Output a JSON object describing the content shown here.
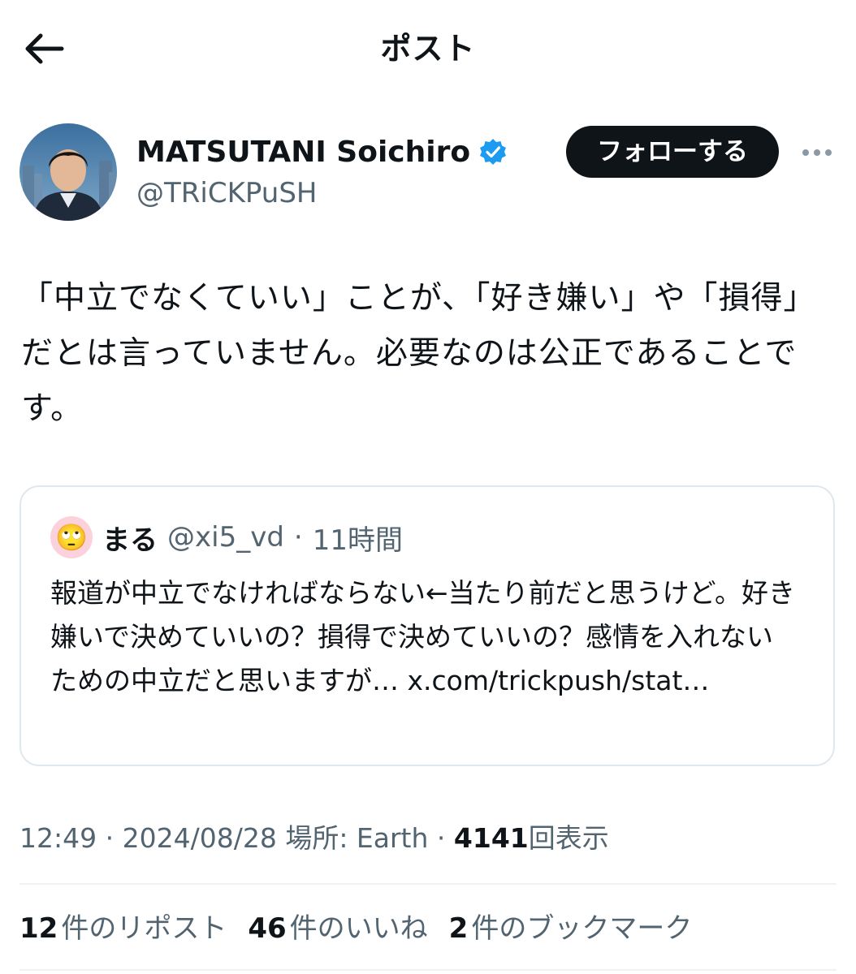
{
  "header": {
    "title": "ポスト",
    "back_icon": "arrow-left-icon"
  },
  "author": {
    "display_name": "MATSUTANI Soichiro",
    "handle": "@TRiCKPuSH",
    "verified_icon": "verified-badge-icon",
    "follow_label": "フォローする",
    "more_icon": "more-horizontal-icon"
  },
  "post": {
    "text": "「中立でなくていい」ことが、「好き嫌い」や「損得」だとは言っていません。必要なのは公正であることです。"
  },
  "quote": {
    "avatar_emoji": "🙄",
    "name": "まる",
    "handle": "@xi5_vd",
    "separator": "·",
    "time": "11時間",
    "text": "報道が中立でなければならない←当たり前だと思うけど。好き嫌いで決めていいの？損得で決めていいの？感情を入れないための中立だと思いますが… ",
    "link": "x.com/trickpush/stat…"
  },
  "meta": {
    "time": "12:49",
    "sep1": "·",
    "date": "2024/08/28",
    "location": "場所: Earth",
    "sep2": "·",
    "views": "4141",
    "views_label": "回表示"
  },
  "stats": {
    "reposts": "12",
    "reposts_label": "件のリポスト",
    "likes": "46",
    "likes_label": "件のいいね",
    "bookmarks": "2",
    "bookmarks_label": "件のブックマーク"
  },
  "colors": {
    "text": "#0f1419",
    "secondary": "#536471",
    "verified": "#1d9bf0",
    "border": "#e1e8ed"
  }
}
